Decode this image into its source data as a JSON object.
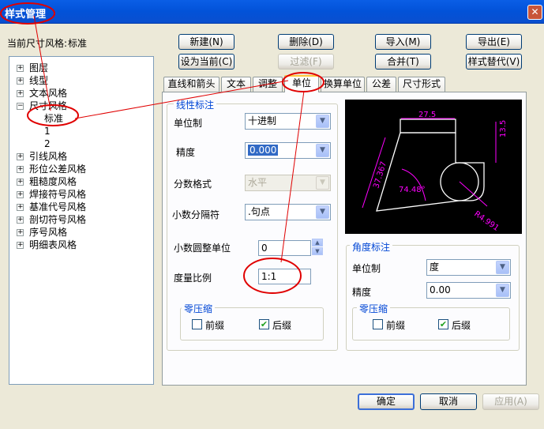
{
  "window": {
    "title": "样式管理",
    "close": "✕"
  },
  "current_style": {
    "label": "当前尺寸风格:",
    "value": "标准"
  },
  "toolbar": {
    "new": "新建(N)",
    "delete": "删除(D)",
    "import": "导入(M)",
    "export": "导出(E)",
    "set_current": "设为当前(C)",
    "filter": "过滤(F)",
    "merge": "合并(T)",
    "replace": "样式替代(V)"
  },
  "tree": {
    "items": [
      "图层",
      "线型",
      "文本风格",
      "尺寸风格",
      "标准",
      "1",
      "2",
      "引线风格",
      "形位公差风格",
      "粗糙度风格",
      "焊接符号风格",
      "基准代号风格",
      "剖切符号风格",
      "序号风格",
      "明细表风格"
    ]
  },
  "tabs": [
    "直线和箭头",
    "文本",
    "调整",
    "单位",
    "换算单位",
    "公差",
    "尺寸形式"
  ],
  "linear": {
    "group_title": "线性标注",
    "unit_label": "单位制",
    "unit_value": "十进制",
    "precision_label": "精度",
    "precision_value": "0.000",
    "fraction_label": "分数格式",
    "fraction_value": "水平",
    "decimal_sep_label": "小数分隔符",
    "decimal_sep_value": ".句点",
    "round_label": "小数圆整单位",
    "round_value": "0",
    "scale_label": "度量比例",
    "scale_value": "1:1",
    "zero_group": "零压缩",
    "leading": "前缀",
    "trailing": "后缀",
    "leading_checked": false,
    "trailing_checked": true
  },
  "angular": {
    "group_title": "角度标注",
    "unit_label": "单位制",
    "unit_value": "度",
    "precision_label": "精度",
    "precision_value": "0.00",
    "zero_group": "零压缩",
    "leading": "前缀",
    "trailing": "后缀",
    "leading_checked": false,
    "trailing_checked": true
  },
  "preview": {
    "dim1": "27.5",
    "dim2": "13.5",
    "dim3": "37.367",
    "angle": "74.48°",
    "radius": "R4.991"
  },
  "footer": {
    "ok": "确定",
    "cancel": "取消",
    "apply": "应用(A)"
  },
  "colors": {
    "title_bar": "#0252d8",
    "annotation_red": "#e00000",
    "preview_bg": "#000000",
    "preview_dim": "#ff00ff",
    "preview_geom": "#ffffff"
  }
}
